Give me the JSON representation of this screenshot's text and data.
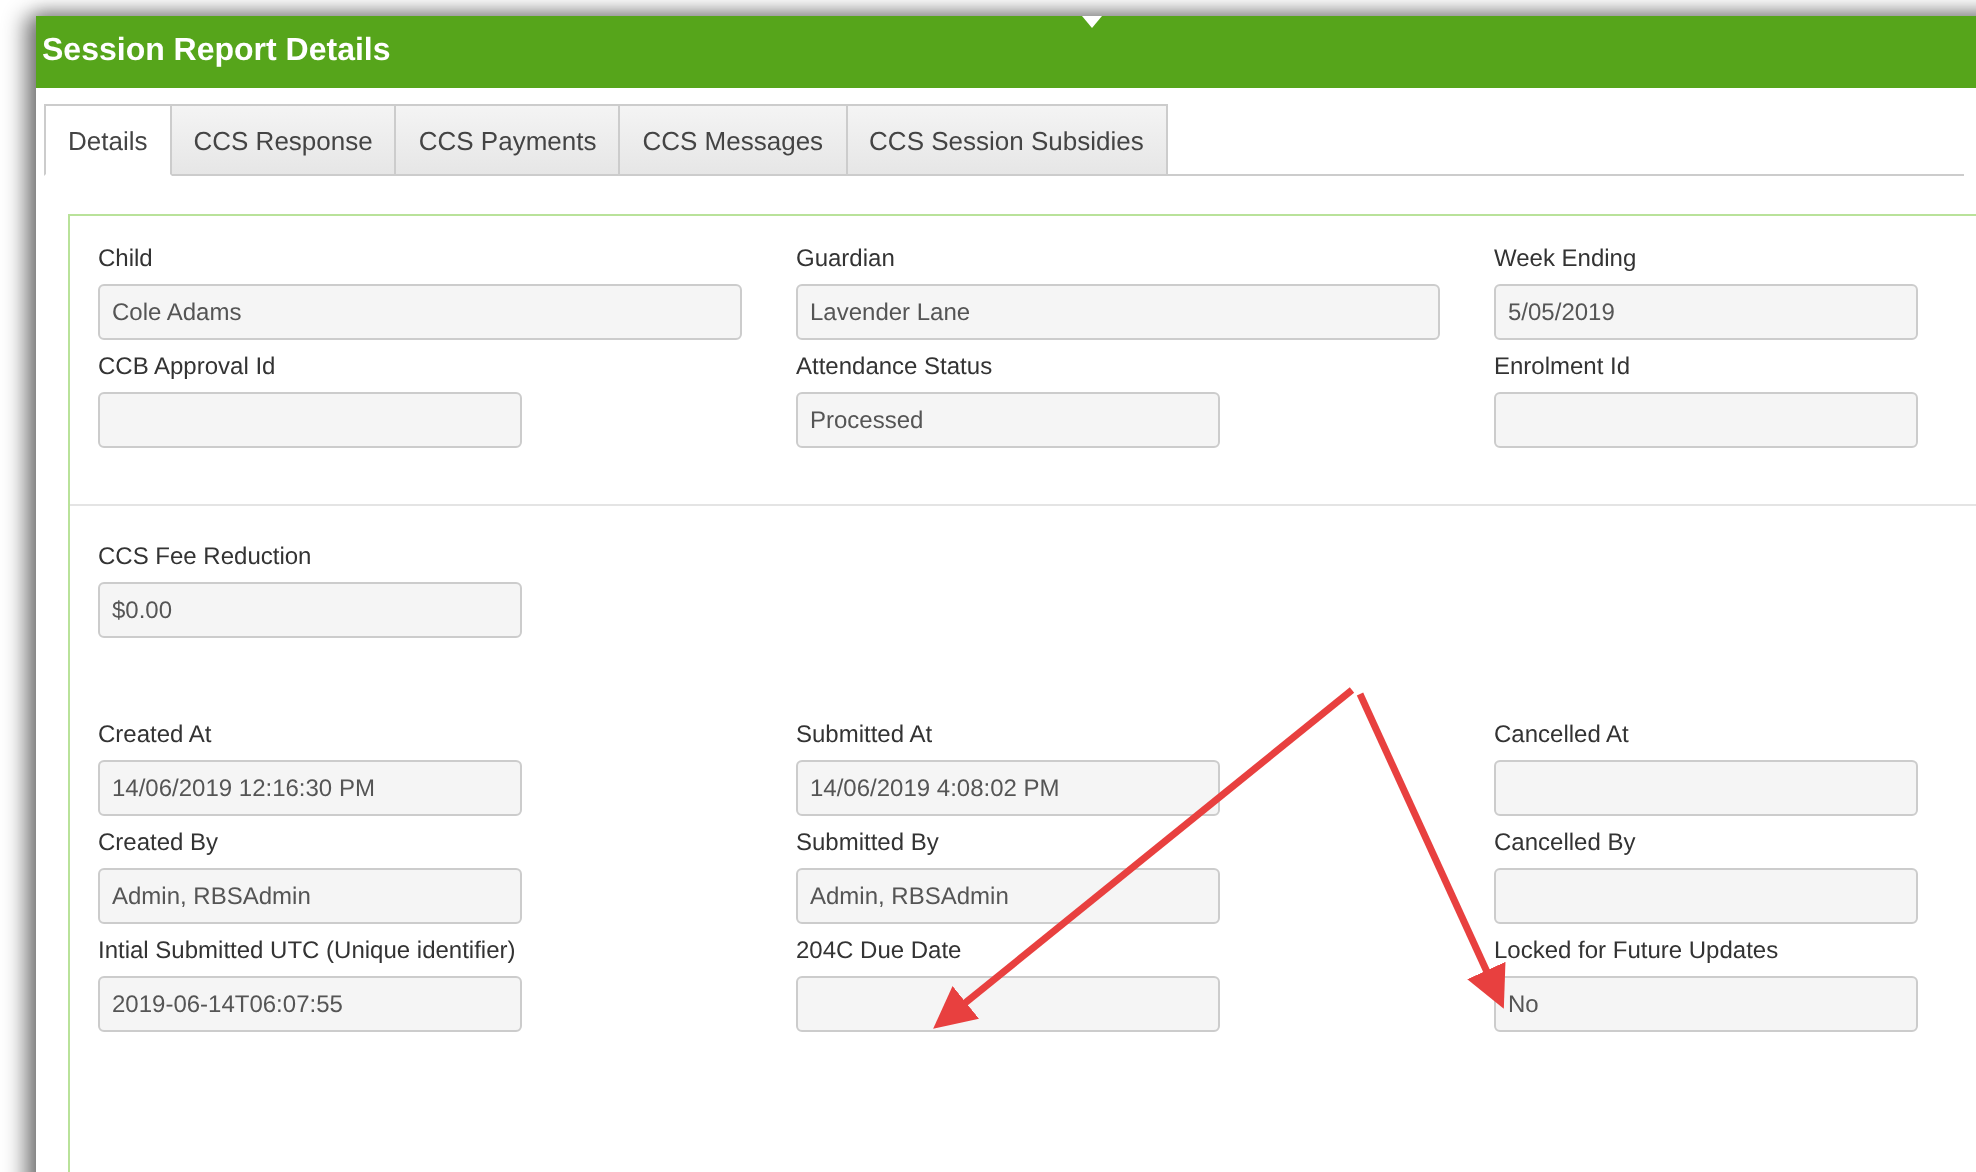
{
  "window": {
    "title": "Session Report Details"
  },
  "tabs": [
    {
      "label": "Details",
      "selected": true
    },
    {
      "label": "CCS Response",
      "selected": false
    },
    {
      "label": "CCS Payments",
      "selected": false
    },
    {
      "label": "CCS Messages",
      "selected": false
    },
    {
      "label": "CCS Session Subsidies",
      "selected": false
    }
  ],
  "sections": [
    {
      "fields": [
        {
          "label": "Child",
          "value": "Cole Adams",
          "kind": "wide"
        },
        {
          "label": "Guardian",
          "value": "Lavender Lane",
          "kind": "wide"
        },
        {
          "label": "Week Ending",
          "value": "5/05/2019",
          "kind": "narrow"
        },
        {
          "label": "CCB Approval Id",
          "kind": "narrow"
        },
        {
          "label": "Attendance Status",
          "value": "Processed",
          "kind": "narrow"
        },
        {
          "label": "Enrolment Id",
          "kind": "narrow"
        }
      ]
    },
    {
      "fields": [
        {
          "label": "CCS Fee Reduction",
          "value": "$0.00",
          "kind": "narrow"
        }
      ]
    },
    {
      "fields": [
        {
          "label": "Created At",
          "value": "14/06/2019 12:16:30 PM",
          "kind": "narrow"
        },
        {
          "label": "Submitted At",
          "value": "14/06/2019 4:08:02 PM",
          "kind": "narrow"
        },
        {
          "label": "Cancelled At",
          "kind": "narrow"
        },
        {
          "label": "Created By",
          "value": "Admin, RBSAdmin",
          "kind": "narrow"
        },
        {
          "label": "Submitted By",
          "value": "Admin, RBSAdmin",
          "kind": "narrow"
        },
        {
          "label": "Cancelled By",
          "kind": "narrow"
        },
        {
          "label": "Intial Submitted UTC (Unique identifier)",
          "value": "2019-06-14T06:07:55",
          "kind": "narrow"
        },
        {
          "label": "204C Due Date",
          "kind": "narrow"
        },
        {
          "label": "Locked for Future Updates",
          "value": "No",
          "kind": "narrow"
        }
      ]
    }
  ]
}
